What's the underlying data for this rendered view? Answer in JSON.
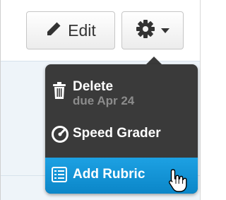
{
  "toolbar": {
    "edit_label": "Edit",
    "edit_icon": "pencil-icon",
    "settings_icon": "gear-icon",
    "dropdown_icon": "caret-down-icon"
  },
  "menu": {
    "items": [
      {
        "label": "Delete",
        "sublabel": "due Apr 24",
        "icon": "trash-icon"
      },
      {
        "label": "Speed Grader",
        "icon": "gauge-icon"
      },
      {
        "label": "Add Rubric",
        "icon": "rubric-icon",
        "highlighted": true
      }
    ]
  },
  "colors": {
    "menu_background": "#3a3a3a",
    "highlight": "#1599dc",
    "panel_background": "#eef4f9"
  }
}
